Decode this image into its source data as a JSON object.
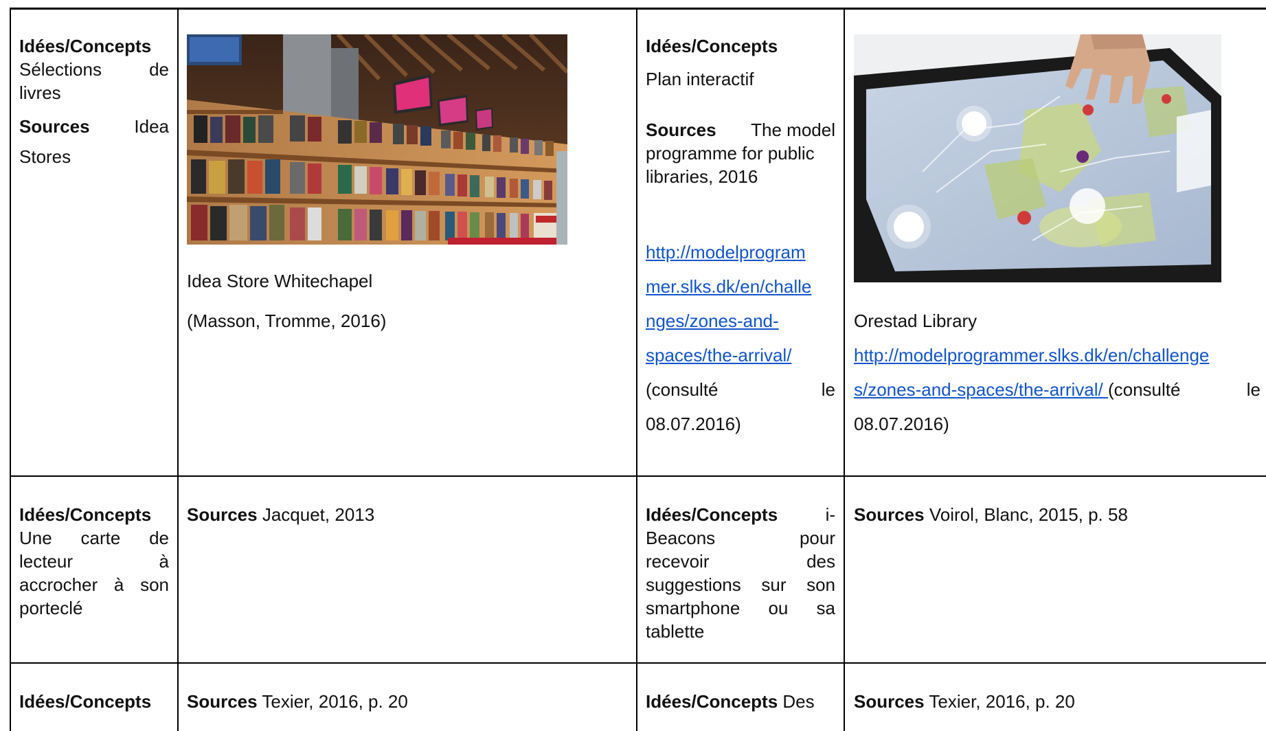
{
  "rows": [
    {
      "left": {
        "ideas_heading": "Idées/Concepts",
        "ideas_line1_a": "Sélections",
        "ideas_line1_b": "de",
        "ideas_line2": "livres",
        "sources_heading": "Sources",
        "sources_word": "Idea",
        "sources_line2": "Stores",
        "image_icon": "bookshelf-photo",
        "caption": "Idea Store Whitechapel",
        "reference": "(Masson, Tromme, 2016)"
      },
      "right": {
        "ideas_heading": "Idées/Concepts",
        "ideas_text": "Plan interactif",
        "sources_heading": "Sources",
        "sources_line1_rest": "The model",
        "sources_line2": "programme for public",
        "sources_line3": "libraries, 2016",
        "link_lines": [
          "http://modelprogram",
          "mer.slks.dk/en/challe",
          "nges/zones-and-",
          "spaces/the-arrival/"
        ],
        "consulted_a": "(consulté",
        "consulted_b": "le",
        "consulted_date": "08.07.2016)",
        "image_icon": "interactive-table-photo",
        "caption": "Orestad Library",
        "caption_link_line1": "http://modelprogrammer.slks.dk/en/challenge",
        "caption_link_line2": "s/zones-and-spaces/the-arrival/ ",
        "caption_consulted_a": "(consulté",
        "caption_consulted_b": "le",
        "caption_date": "08.07.2016)"
      }
    },
    {
      "left": {
        "ideas_heading": "Idées/Concepts",
        "ideas_lines": [
          [
            "Une",
            "carte",
            "de"
          ],
          [
            "lecteur",
            "à"
          ],
          [
            "accrocher",
            "à",
            "son"
          ],
          [
            "porteclé"
          ]
        ],
        "sources_heading": "Sources",
        "sources_text": "Jacquet, 2013"
      },
      "right": {
        "ideas_heading": "Idées/Concepts",
        "ideas_first": "i-",
        "ideas_lines": [
          [
            "Beacons",
            "pour"
          ],
          [
            "recevoir",
            "des"
          ],
          [
            "suggestions",
            "sur",
            "son"
          ],
          [
            "smartphone",
            "ou",
            "sa"
          ],
          [
            "tablette"
          ]
        ],
        "sources_heading": "Sources",
        "sources_text": "Voirol, Blanc, 2015, p. 58"
      }
    },
    {
      "left": {
        "ideas_heading": "Idées/Concepts",
        "sources_heading": "Sources",
        "sources_text": "Texier, 2016, p. 20"
      },
      "right": {
        "ideas_heading": "Idées/Concepts",
        "ideas_first": "Des",
        "sources_heading": "Sources",
        "sources_text": "Texier, 2016, p. 20"
      }
    }
  ]
}
